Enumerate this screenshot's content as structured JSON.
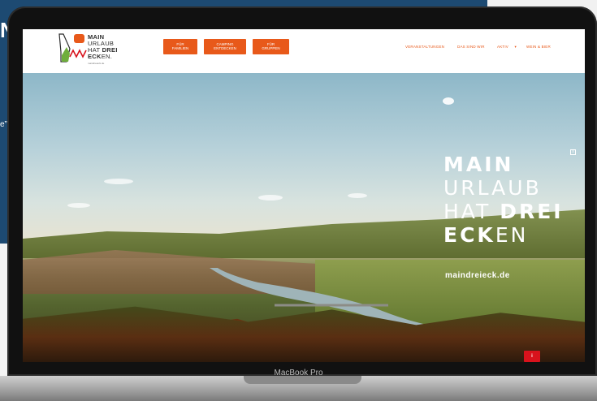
{
  "background": {
    "letter": "N",
    "quote_mark": "e”"
  },
  "device": {
    "label": "MacBook Pro"
  },
  "site": {
    "logo": {
      "line1": "MAIN",
      "line2": "URLAUB",
      "line3_a": "HAT ",
      "line3_b": "DREI",
      "line4_a": "ECK",
      "line4_b": "EN.",
      "sub": "maindreieck.de"
    },
    "buttons": [
      {
        "line1": "FÜR",
        "line2": "FAMILIEN"
      },
      {
        "line1": "CAMPING",
        "line2": "ENTDECKEN"
      },
      {
        "line1": "FÜR",
        "line2": "GRUPPEN"
      }
    ],
    "menu": {
      "item1": "VERANSTALTUNGEN",
      "item2": "DAS SIND WIR",
      "item3": "AKTIV",
      "item3_caret": "▾",
      "item4": "WEIN & BIER"
    },
    "hero": {
      "line1": "MAIN",
      "line2": "URLAUB",
      "line3_a": "HAT ",
      "line3_b": "DREI",
      "line4_a": "ECK",
      "line4_b": "EN",
      "url": "maindreieck.de",
      "close_glyph": "x",
      "info_glyph": "i"
    },
    "colors": {
      "accent": "#e8591a",
      "badge": "#d8121c"
    }
  }
}
